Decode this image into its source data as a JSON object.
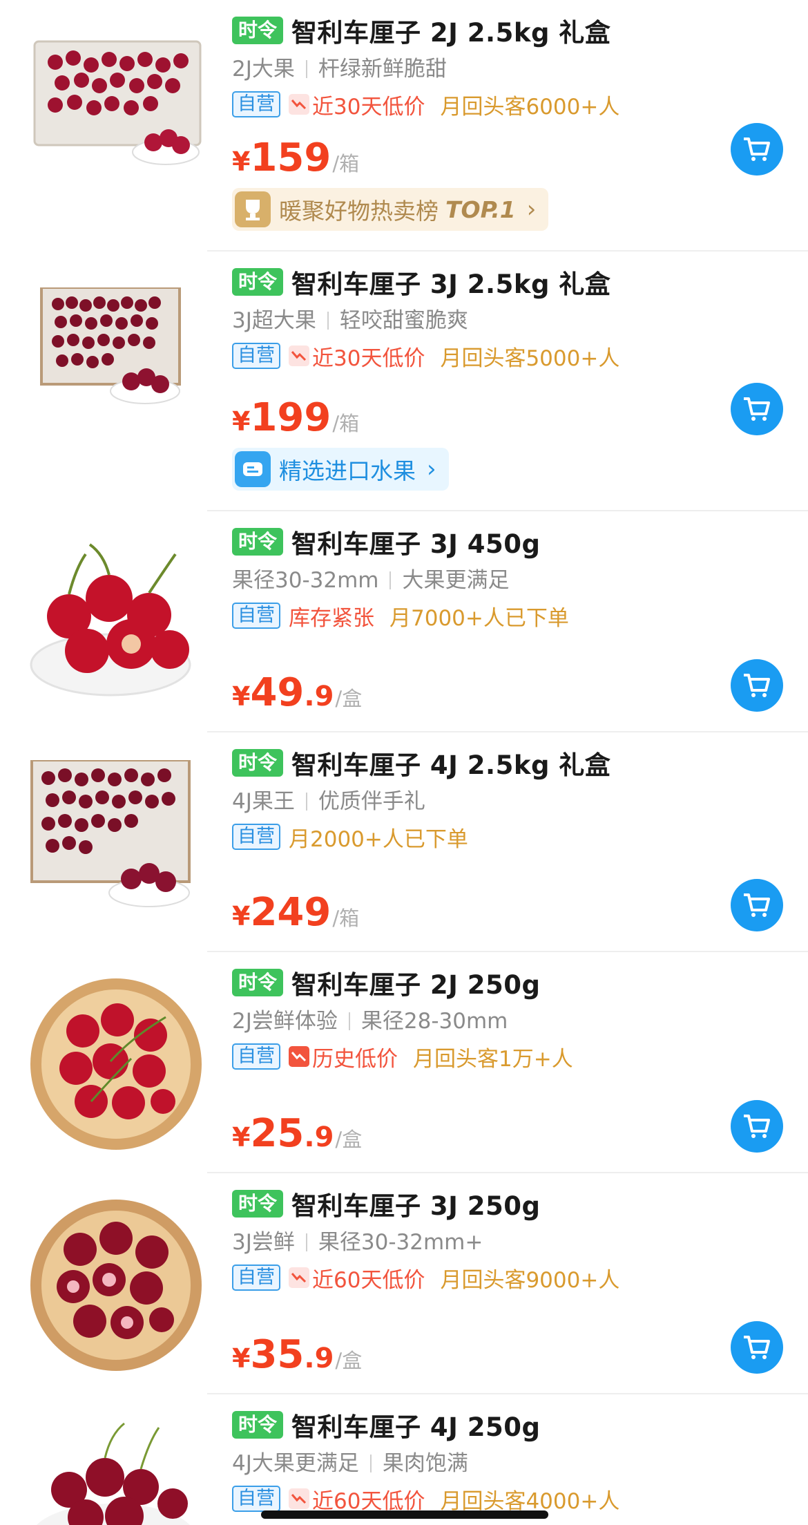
{
  "colors": {
    "season_tag": "#3ec35c",
    "self_tag": "#2a8fe0",
    "price": "#f2401f",
    "low_price": "#f2543d",
    "buy_count": "#d99a2e",
    "cart": "#1a9cf2"
  },
  "products": [
    {
      "tag": "时令",
      "title": "智利车厘子 2J 2.5kg 礼盒",
      "sub_a": "2J大果",
      "sub_b": "杆绿新鲜脆甜",
      "self_tag": "自营",
      "low_label": "近30天低价",
      "buy_label": "月回头客6000+人",
      "yen": "¥",
      "price_int": "159",
      "price_dec": "",
      "unit": "/箱",
      "badge": "暖聚好物热卖榜",
      "badge_extra": "TOP.1",
      "image_icon": "cherry-box-icon"
    },
    {
      "tag": "时令",
      "title": "智利车厘子 3J 2.5kg 礼盒",
      "sub_a": "3J超大果",
      "sub_b": "轻咬甜蜜脆爽",
      "self_tag": "自营",
      "low_label": "近30天低价",
      "buy_label": "月回头客5000+人",
      "yen": "¥",
      "price_int": "199",
      "price_dec": "",
      "unit": "/箱",
      "badge": "精选进口水果",
      "image_icon": "cherry-box-icon"
    },
    {
      "tag": "时令",
      "title": "智利车厘子 3J 450g",
      "sub_a": "果径30-32mm",
      "sub_b": "大果更满足",
      "self_tag": "自营",
      "low_label": "库存紧张",
      "buy_label": "月7000+人已下单",
      "yen": "¥",
      "price_int": "49",
      "price_dec": ".9",
      "unit": "/盒",
      "image_icon": "cherry-bowl-icon"
    },
    {
      "tag": "时令",
      "title": "智利车厘子 4J 2.5kg 礼盒",
      "sub_a": "4J果王",
      "sub_b": "优质伴手礼",
      "self_tag": "自营",
      "buy_label": "月2000+人已下单",
      "yen": "¥",
      "price_int": "249",
      "price_dec": "",
      "unit": "/箱",
      "image_icon": "cherry-box-icon"
    },
    {
      "tag": "时令",
      "title": "智利车厘子 2J 250g",
      "sub_a": "2J尝鲜体验",
      "sub_b": "果径28-30mm",
      "self_tag": "自营",
      "low_label": "历史低价",
      "buy_label": "月回头客1万+人",
      "yen": "¥",
      "price_int": "25",
      "price_dec": ".9",
      "unit": "/盒",
      "image_icon": "cherry-plate-icon"
    },
    {
      "tag": "时令",
      "title": "智利车厘子 3J 250g",
      "sub_a": "3J尝鲜",
      "sub_b": "果径30-32mm+",
      "self_tag": "自营",
      "low_label": "近60天低价",
      "buy_label": "月回头客9000+人",
      "yen": "¥",
      "price_int": "35",
      "price_dec": ".9",
      "unit": "/盒",
      "image_icon": "cherry-plate-icon"
    },
    {
      "tag": "时令",
      "title": "智利车厘子 4J 250g",
      "sub_a": "4J大果更满足",
      "sub_b": "果肉饱满",
      "self_tag": "自营",
      "low_label": "近60天低价",
      "buy_label": "月回头客4000+人",
      "image_icon": "cherry-bowl-icon"
    }
  ]
}
